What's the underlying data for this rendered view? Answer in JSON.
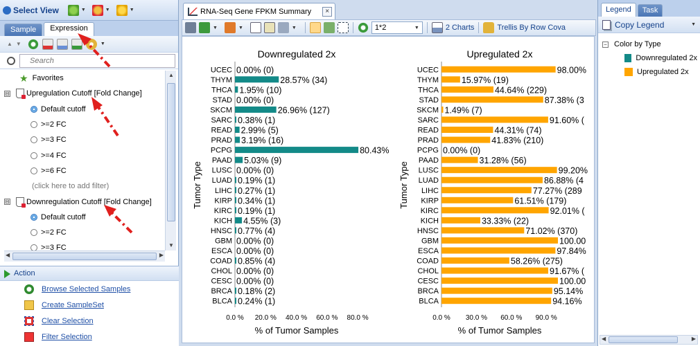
{
  "select_view": {
    "title": "Select View",
    "tabs": [
      {
        "label": "Sample",
        "active": false
      },
      {
        "label": "Expression",
        "active": true
      }
    ],
    "search_placeholder": "Search",
    "tree": {
      "favorites": "Favorites",
      "upreg_group": "Upregulation Cutoff [Fold Change]",
      "upreg_options": [
        "Default cutoff",
        ">=2 FC",
        ">=3 FC",
        ">=4 FC",
        ">=6 FC"
      ],
      "add_filter_hint": "(click here to add filter)",
      "downreg_group": "Downregulation Cutoff [Fold Change]",
      "downreg_options": [
        "Default cutoff",
        ">=2 FC",
        ">=3 FC"
      ],
      "expander_symbol": "⊟"
    }
  },
  "action": {
    "title": "Action",
    "items": [
      "Browse Selected Samples",
      "Create SampleSet",
      "Clear Selection",
      "Filter Selection"
    ]
  },
  "document": {
    "tab_title": "RNA-Seq Gene FPKM Summary",
    "close_symbol": "×",
    "toolbar": {
      "layout_value": "1*2",
      "charts_label": "2 Charts",
      "trellis_label": "Trellis By Row Cova"
    }
  },
  "right_panel": {
    "tabs": [
      {
        "label": "Legend",
        "active": true
      },
      {
        "label": "Task",
        "active": false
      }
    ],
    "copy_legend": "Copy Legend",
    "color_by": "Color by Type",
    "entries": [
      {
        "label": "Downregulated 2x",
        "color": "#138a88"
      },
      {
        "label": "Upregulated 2x",
        "color": "#ffa500"
      }
    ]
  },
  "chart_data": [
    {
      "type": "bar",
      "orientation": "horizontal",
      "title": "Downregulated 2x",
      "xlabel": "% of Tumor Samples",
      "ylabel": "Tumor Type",
      "color": "#138a88",
      "xlim": [
        0,
        80.4
      ],
      "xticks": [
        0,
        20,
        40,
        60,
        80
      ],
      "xtick_labels": [
        "0.0 %",
        "20.0 %",
        "40.0 %",
        "60.0 %",
        "80.0 %"
      ],
      "categories": [
        "UCEC",
        "THYM",
        "THCA",
        "STAD",
        "SKCM",
        "SARC",
        "READ",
        "PRAD",
        "PCPG",
        "PAAD",
        "LUSC",
        "LUAD",
        "LIHC",
        "KIRP",
        "KIRC",
        "KICH",
        "HNSC",
        "GBM",
        "ESCA",
        "COAD",
        "CHOL",
        "CESC",
        "BRCA",
        "BLCA"
      ],
      "values": [
        0,
        28.57,
        1.95,
        0,
        26.96,
        0.38,
        2.99,
        3.19,
        80.43,
        5.03,
        0,
        0.19,
        0.27,
        0.34,
        0.19,
        4.55,
        0.77,
        0,
        0,
        0.85,
        0,
        0,
        0.18,
        0.24
      ],
      "labels": [
        "0.00% (0)",
        "28.57% (34)",
        "1.95% (10)",
        "0.00% (0)",
        "26.96% (127)",
        "0.38% (1)",
        "2.99% (5)",
        "3.19% (16)",
        "80.43%",
        "5.03% (9)",
        "0.00% (0)",
        "0.19% (1)",
        "0.27% (1)",
        "0.34% (1)",
        "0.19% (1)",
        "4.55% (3)",
        "0.77% (4)",
        "0.00% (0)",
        "0.00% (0)",
        "0.85% (4)",
        "0.00% (0)",
        "0.00% (0)",
        "0.18% (2)",
        "0.24% (1)"
      ]
    },
    {
      "type": "bar",
      "orientation": "horizontal",
      "title": "Upregulated 2x",
      "xlabel": "% of Tumor Samples",
      "ylabel": "Tumor Type",
      "color": "#ffa500",
      "xlim": [
        0,
        100
      ],
      "xticks": [
        0,
        30,
        60,
        90
      ],
      "xtick_labels": [
        "0.0 %",
        "30.0 %",
        "60.0 %",
        "90.0 %"
      ],
      "categories": [
        "UCEC",
        "THYM",
        "THCA",
        "STAD",
        "SKCM",
        "SARC",
        "READ",
        "PRAD",
        "PCPG",
        "PAAD",
        "LUSC",
        "LUAD",
        "LIHC",
        "KIRP",
        "KIRC",
        "KICH",
        "HNSC",
        "GBM",
        "ESCA",
        "COAD",
        "CHOL",
        "CESC",
        "BRCA",
        "BLCA"
      ],
      "values": [
        98.0,
        15.97,
        44.64,
        87.38,
        1.49,
        91.6,
        44.31,
        41.83,
        0,
        31.28,
        99.2,
        86.88,
        77.27,
        61.51,
        92.01,
        33.33,
        71.02,
        100,
        97.84,
        58.26,
        91.67,
        100,
        95.14,
        94.16
      ],
      "labels": [
        "98.00%",
        "15.97% (19)",
        "44.64% (229)",
        "87.38% (3",
        "1.49% (7)",
        "91.60% (",
        "44.31% (74)",
        "41.83% (210)",
        "0.00% (0)",
        "31.28% (56)",
        "99.20%",
        "86.88% (4",
        "77.27% (289",
        "61.51% (179)",
        "92.01% (",
        "33.33% (22)",
        "71.02% (370)",
        "100.00",
        "97.84%",
        "58.26% (275)",
        "91.67% (",
        "100.00",
        "95.14%",
        "94.16%"
      ]
    }
  ]
}
